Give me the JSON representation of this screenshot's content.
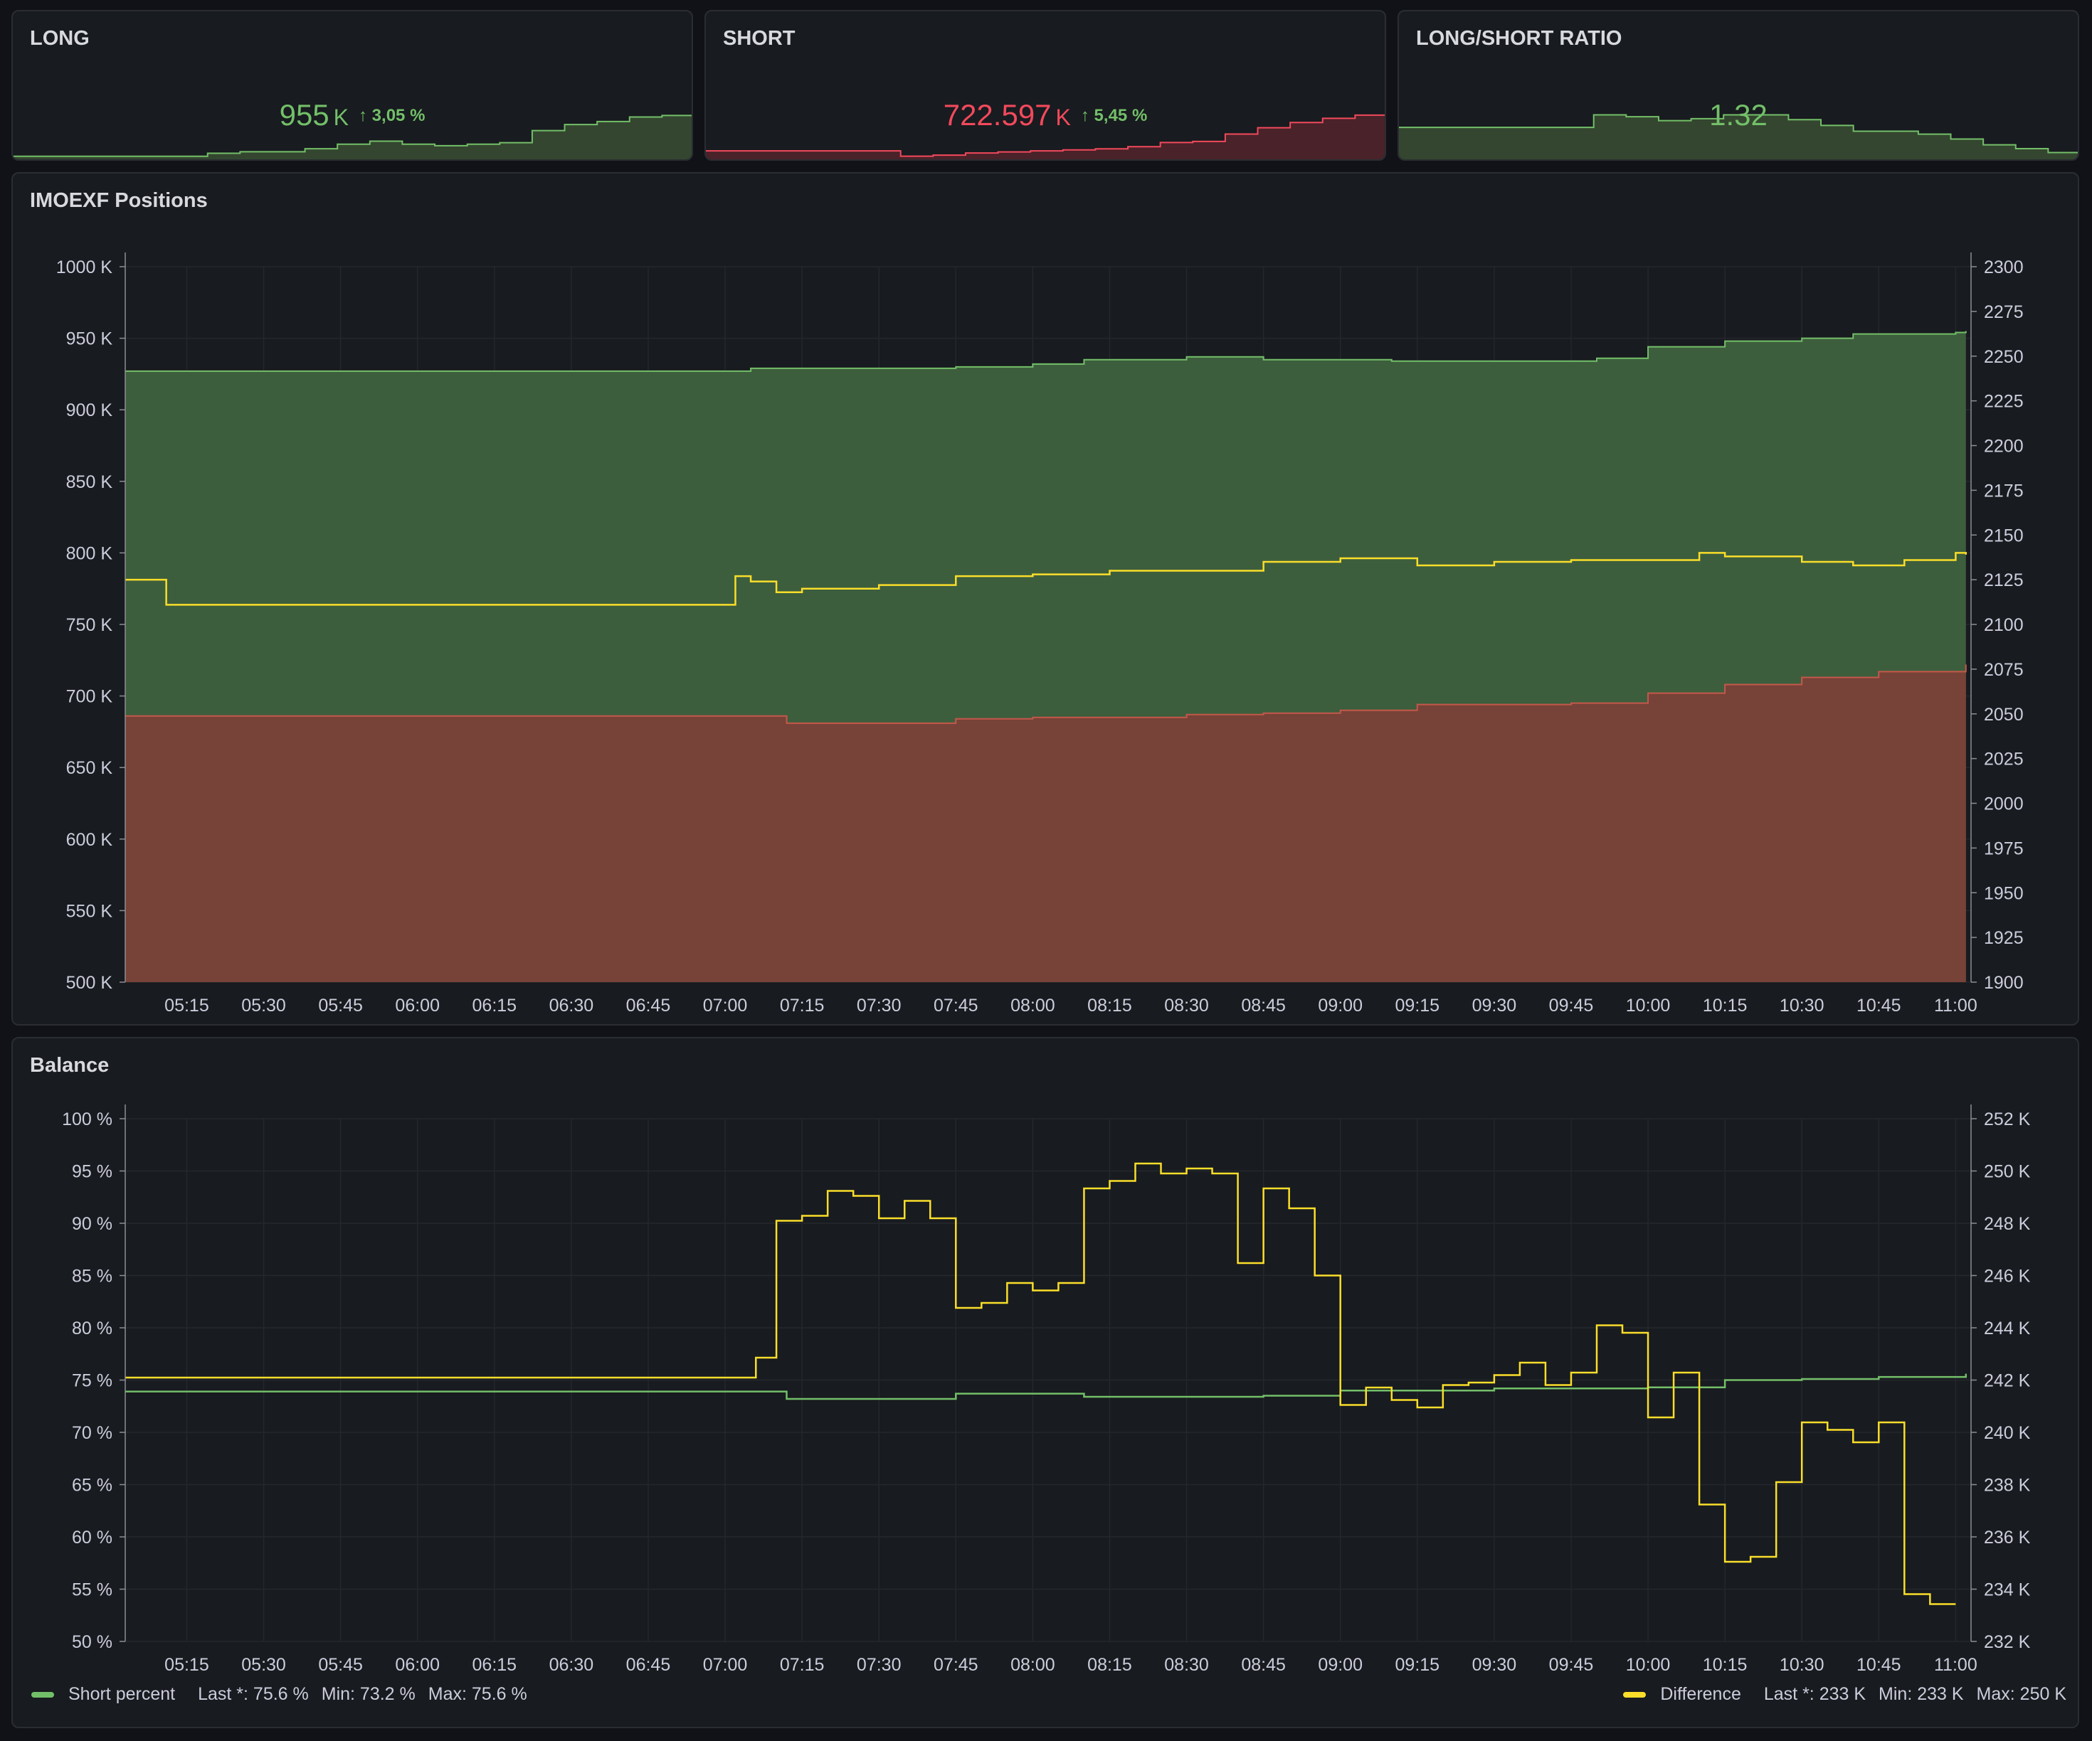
{
  "stats": [
    {
      "title": "LONG",
      "value": "955",
      "unit": "K",
      "delta": "↑ 3,05 %",
      "color": "#73bf69",
      "fill": "#3b4f37"
    },
    {
      "title": "SHORT",
      "value": "722.597",
      "unit": "K",
      "delta": "↑ 5,45 %",
      "color": "#f2495c",
      "delta_color": "#73bf69",
      "fill": "#5a262e"
    },
    {
      "title": "LONG/SHORT RATIO",
      "value": "1.32",
      "unit": "",
      "delta": "",
      "color": "#73bf69",
      "fill": "#3b4f37"
    }
  ],
  "x_ticks": [
    "05:15",
    "05:30",
    "05:45",
    "06:00",
    "06:15",
    "06:30",
    "06:45",
    "07:00",
    "07:15",
    "07:30",
    "07:45",
    "08:00",
    "08:15",
    "08:30",
    "08:45",
    "09:00",
    "09:15",
    "09:30",
    "09:45",
    "10:00",
    "10:15",
    "10:30",
    "10:45",
    "11:00"
  ],
  "chart_data": [
    {
      "type": "area",
      "title": "IMOEXF Positions",
      "x_range": [
        "05:03",
        "11:03"
      ],
      "y_left": {
        "ticks": [
          "500 K",
          "550 K",
          "600 K",
          "650 K",
          "700 K",
          "750 K",
          "800 K",
          "850 K",
          "900 K",
          "950 K",
          "1000 K"
        ],
        "range": [
          500,
          1000
        ]
      },
      "y_right": {
        "ticks": [
          "1900",
          "1925",
          "1950",
          "1975",
          "2000",
          "2025",
          "2050",
          "2075",
          "2100",
          "2125",
          "2150",
          "2175",
          "2200",
          "2225",
          "2250",
          "2275",
          "2300"
        ],
        "range": [
          1900,
          2300
        ]
      },
      "series": [
        {
          "color": "#73bf69",
          "fill": "#3d5e3d",
          "axis": "left",
          "x": [
            "05:03",
            "07:00",
            "07:05",
            "07:45",
            "08:00",
            "08:10",
            "08:30",
            "08:45",
            "09:10",
            "09:50",
            "10:00",
            "10:15",
            "10:30",
            "10:40",
            "11:00",
            "11:02"
          ],
          "values": [
            927,
            927,
            929,
            930,
            932,
            935,
            937,
            935,
            934,
            936,
            944,
            948,
            950,
            953,
            954,
            955
          ]
        },
        {
          "color": "#c4584a",
          "fill": "#774238",
          "axis": "left",
          "x": [
            "05:03",
            "07:00",
            "07:12",
            "07:45",
            "08:00",
            "08:30",
            "08:45",
            "09:00",
            "09:15",
            "09:45",
            "10:00",
            "10:15",
            "10:30",
            "10:45",
            "11:02"
          ],
          "values": [
            686,
            686,
            681,
            684,
            685,
            687,
            688,
            690,
            694,
            695,
            702,
            708,
            713,
            717,
            722
          ]
        },
        {
          "color": "#fade2a",
          "axis": "right",
          "x": [
            "05:03",
            "05:11",
            "07:00",
            "07:02",
            "07:05",
            "07:10",
            "07:15",
            "07:30",
            "07:45",
            "08:00",
            "08:15",
            "08:30",
            "08:45",
            "09:00",
            "09:15",
            "09:30",
            "09:45",
            "10:00",
            "10:10",
            "10:15",
            "10:30",
            "10:40",
            "10:50",
            "11:00",
            "11:02"
          ],
          "values": [
            2125,
            2111,
            2111,
            2127,
            2124,
            2118,
            2120,
            2122,
            2127,
            2128,
            2130,
            2130,
            2135,
            2137,
            2133,
            2135,
            2136,
            2136,
            2140,
            2138,
            2135,
            2133,
            2136,
            2140,
            2139
          ]
        }
      ]
    },
    {
      "type": "line",
      "title": "Balance",
      "x_range": [
        "05:03",
        "11:03"
      ],
      "y_left": {
        "ticks": [
          "50 %",
          "55 %",
          "60 %",
          "65 %",
          "70 %",
          "75 %",
          "80 %",
          "85 %",
          "90 %",
          "95 %",
          "100 %"
        ],
        "range": [
          50,
          100
        ]
      },
      "y_right": {
        "ticks": [
          "232 K",
          "234 K",
          "236 K",
          "238 K",
          "240 K",
          "242 K",
          "244 K",
          "246 K",
          "248 K",
          "250 K",
          "252 K"
        ],
        "range": [
          231,
          252
        ]
      },
      "series": [
        {
          "name": "Short percent",
          "color": "#73bf69",
          "axis": "left",
          "x": [
            "05:03",
            "07:00",
            "07:12",
            "07:45",
            "08:10",
            "08:45",
            "09:00",
            "09:30",
            "10:00",
            "10:15",
            "10:30",
            "10:45",
            "11:02"
          ],
          "values": [
            73.9,
            73.9,
            73.2,
            73.7,
            73.4,
            73.5,
            74.0,
            74.2,
            74.3,
            75.0,
            75.1,
            75.3,
            75.6
          ]
        },
        {
          "name": "Difference",
          "color": "#fade2a",
          "axis": "right",
          "x": [
            "05:03",
            "07:05",
            "07:06",
            "07:10",
            "07:15",
            "07:20",
            "07:25",
            "07:30",
            "07:35",
            "07:40",
            "07:45",
            "07:50",
            "07:55",
            "08:00",
            "08:05",
            "08:10",
            "08:15",
            "08:20",
            "08:25",
            "08:30",
            "08:35",
            "08:40",
            "08:45",
            "08:50",
            "08:55",
            "09:00",
            "09:05",
            "09:10",
            "09:15",
            "09:20",
            "09:25",
            "09:30",
            "09:35",
            "09:40",
            "09:45",
            "09:50",
            "09:55",
            "10:00",
            "10:05",
            "10:10",
            "10:15",
            "10:20",
            "10:25",
            "10:30",
            "10:35",
            "10:40",
            "10:45",
            "10:50",
            "10:55",
            "11:00"
          ],
          "values": [
            241.6,
            241.6,
            242.4,
            247.9,
            248.1,
            249.1,
            248.9,
            248.0,
            248.7,
            248.0,
            244.4,
            244.6,
            245.4,
            245.1,
            245.4,
            249.2,
            249.5,
            250.2,
            249.8,
            250.0,
            249.8,
            246.2,
            249.2,
            248.4,
            245.7,
            240.5,
            241.2,
            240.7,
            240.4,
            241.3,
            241.4,
            241.7,
            242.2,
            241.3,
            241.8,
            243.7,
            243.4,
            240.0,
            241.8,
            236.5,
            234.2,
            234.4,
            237.4,
            239.8,
            239.5,
            239.0,
            239.8,
            232.9,
            232.5,
            232.5
          ]
        }
      ],
      "legend": [
        {
          "name": "Short percent",
          "color": "#73bf69",
          "stats": [
            "Last *: 75.6 %",
            "Min: 73.2 %",
            "Max: 75.6 %"
          ]
        },
        {
          "name": "Difference",
          "color": "#fade2a",
          "stats": [
            "Last *: 233 K",
            "Min: 233 K",
            "Max: 250 K"
          ]
        }
      ]
    }
  ],
  "sparklines": {
    "long": [
      927,
      927,
      927,
      927,
      927,
      927,
      929,
      930,
      930,
      932,
      935,
      937,
      935,
      934,
      935,
      936,
      944,
      948,
      950,
      953,
      954,
      955
    ],
    "short": [
      686,
      686,
      686,
      686,
      686,
      686,
      681,
      682,
      684,
      685,
      686,
      687,
      688,
      690,
      694,
      695,
      702,
      708,
      713,
      717,
      720,
      722
    ],
    "ratio": [
      1.351,
      1.351,
      1.351,
      1.351,
      1.351,
      1.351,
      1.364,
      1.362,
      1.358,
      1.36,
      1.364,
      1.364,
      1.359,
      1.353,
      1.347,
      1.347,
      1.344,
      1.339,
      1.333,
      1.329,
      1.325,
      1.322
    ]
  }
}
